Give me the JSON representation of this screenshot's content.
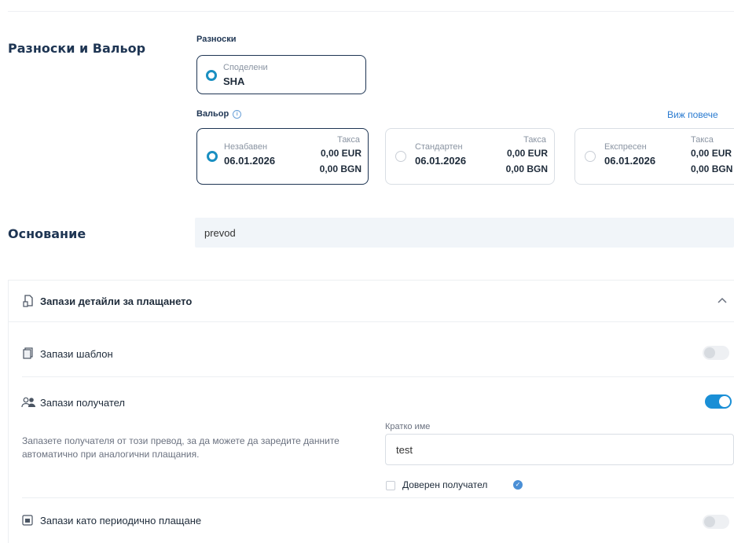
{
  "charges_value": {
    "section_title": "Разноски и Вальор",
    "charges_label": "Разноски",
    "charges_option": {
      "sub": "Споделени",
      "value": "SHA"
    },
    "value_date_label": "Вальор",
    "info_glyph": "i",
    "see_more": "Виж повече",
    "options": [
      {
        "name": "Незабавен",
        "date": "06.01.2026",
        "fee_label": "Такса",
        "eur": "0,00 EUR",
        "bgn": "0,00 BGN",
        "selected": true
      },
      {
        "name": "Стандартен",
        "date": "06.01.2026",
        "fee_label": "Такса",
        "eur": "0,00 EUR",
        "bgn": "0,00 BGN",
        "selected": false
      },
      {
        "name": "Експресен",
        "date": "06.01.2026",
        "fee_label": "Такса",
        "eur": "0,00 EUR",
        "bgn": "0,00 BGN",
        "selected": false
      }
    ]
  },
  "reason": {
    "label": "Основание",
    "value": "prevod"
  },
  "save_panel": {
    "title": "Запази детайли за плащането",
    "template": {
      "label": "Запази шаблон",
      "enabled": false
    },
    "recipient": {
      "label": "Запази получател",
      "enabled": true,
      "description": "Запазете получателя от този превод, за да можете да заредите данните автоматично при аналогични плащания.",
      "short_name_label": "Кратко име",
      "short_name_value": "test",
      "trusted_label": "Доверен получател",
      "trusted_checked": false
    },
    "periodic": {
      "label": "Запази като периодично плащане",
      "enabled": false
    }
  },
  "icons": {
    "chevron": "chevron-up-icon",
    "save_details": "save-doc-icon",
    "template": "template-icon",
    "recipient": "users-icon",
    "periodic": "calendar-icon",
    "verified": "verified-badge-icon"
  },
  "colors": {
    "accent": "#1a8fd6",
    "radio": "#1a8fc1",
    "title": "#1e3553",
    "link": "#2a7bd0"
  }
}
